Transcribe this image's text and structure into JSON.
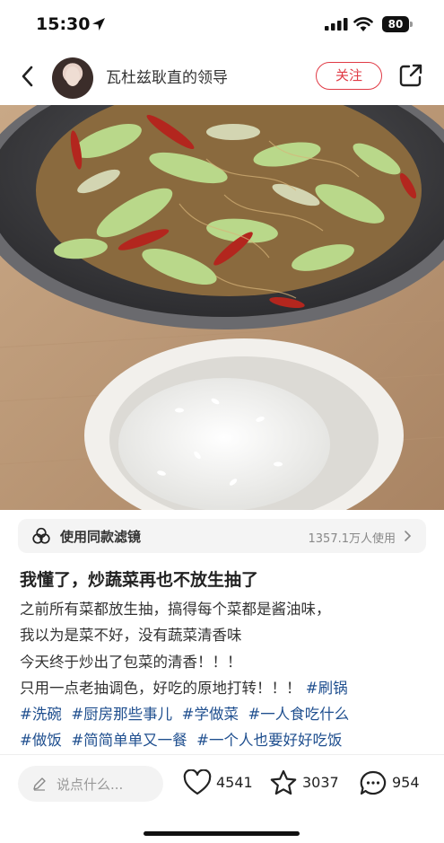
{
  "status_bar": {
    "time": "15:30",
    "battery": "80"
  },
  "nav": {
    "username": "瓦杜兹耿直的领导",
    "follow_label": "关注"
  },
  "photo": {
    "icon": "food-photo"
  },
  "filter": {
    "label": "使用同款滤镜",
    "count": "1357.1万人使用"
  },
  "post": {
    "title": "我懂了，炒蔬菜再也不放生抽了",
    "lines": [
      "之前所有菜都放生抽，搞得每个菜都是酱油味，",
      "我以为是菜不好，没有蔬菜清香味",
      "今天终于炒出了包菜的清香！！！",
      "只用一点老抽调色，好吃的原地打转！！！"
    ],
    "tags": [
      "#刷锅",
      "#洗碗",
      "#厨房那些事儿",
      "#学做菜",
      "#一人食吃什么",
      "#做饭",
      "#简简单单又一餐",
      "#一个人也要好好吃饭"
    ]
  },
  "bottom": {
    "comment_placeholder": "说点什么...",
    "likes": "4541",
    "stars": "3037",
    "comments": "954"
  },
  "colors": {
    "accent": "#e03a45",
    "tag": "#1f4f8f"
  }
}
